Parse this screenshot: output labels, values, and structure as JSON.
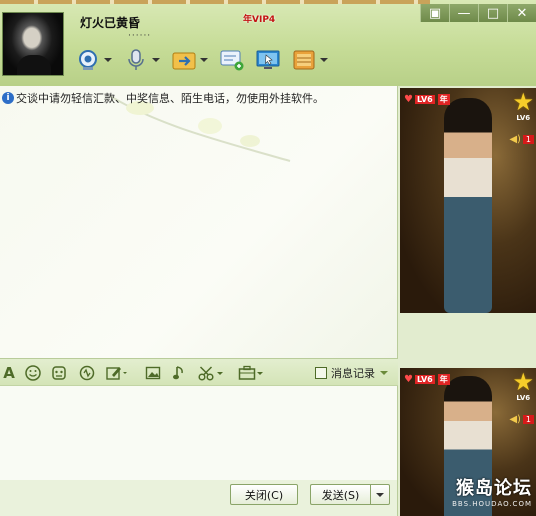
{
  "header": {
    "name": "灯火已黄昏",
    "status": "······",
    "vip_badge": "年VIP4",
    "window_controls": [
      "▣",
      "—",
      "□",
      "✕"
    ],
    "toolbar": [
      {
        "icon": "webcam-icon",
        "has_menu": true
      },
      {
        "icon": "microphone-icon",
        "has_menu": true
      },
      {
        "icon": "file-transfer-icon",
        "has_menu": true
      },
      {
        "icon": "sms-add-icon",
        "has_menu": false
      },
      {
        "icon": "remote-assist-icon",
        "has_menu": false
      },
      {
        "icon": "apps-icon",
        "has_menu": true
      }
    ]
  },
  "chat": {
    "notice": "交谈中请勿轻信汇款、中奖信息、陌生电话，勿使用外挂软件。"
  },
  "format_bar": {
    "history_label": "消息记录"
  },
  "input": {
    "value": ""
  },
  "buttons": {
    "close": "关闭(C)",
    "send": "发送(S)"
  },
  "right_panel": {
    "video1": {
      "level": "LV6",
      "tag": "年",
      "star_level": "LV6",
      "count": "1"
    },
    "video2": {
      "level": "LV6",
      "tag": "年",
      "star_level": "LV6",
      "count": "1"
    },
    "watermark_main": "猴岛论坛",
    "watermark_url": "BBS.HOUDAO.COM"
  }
}
